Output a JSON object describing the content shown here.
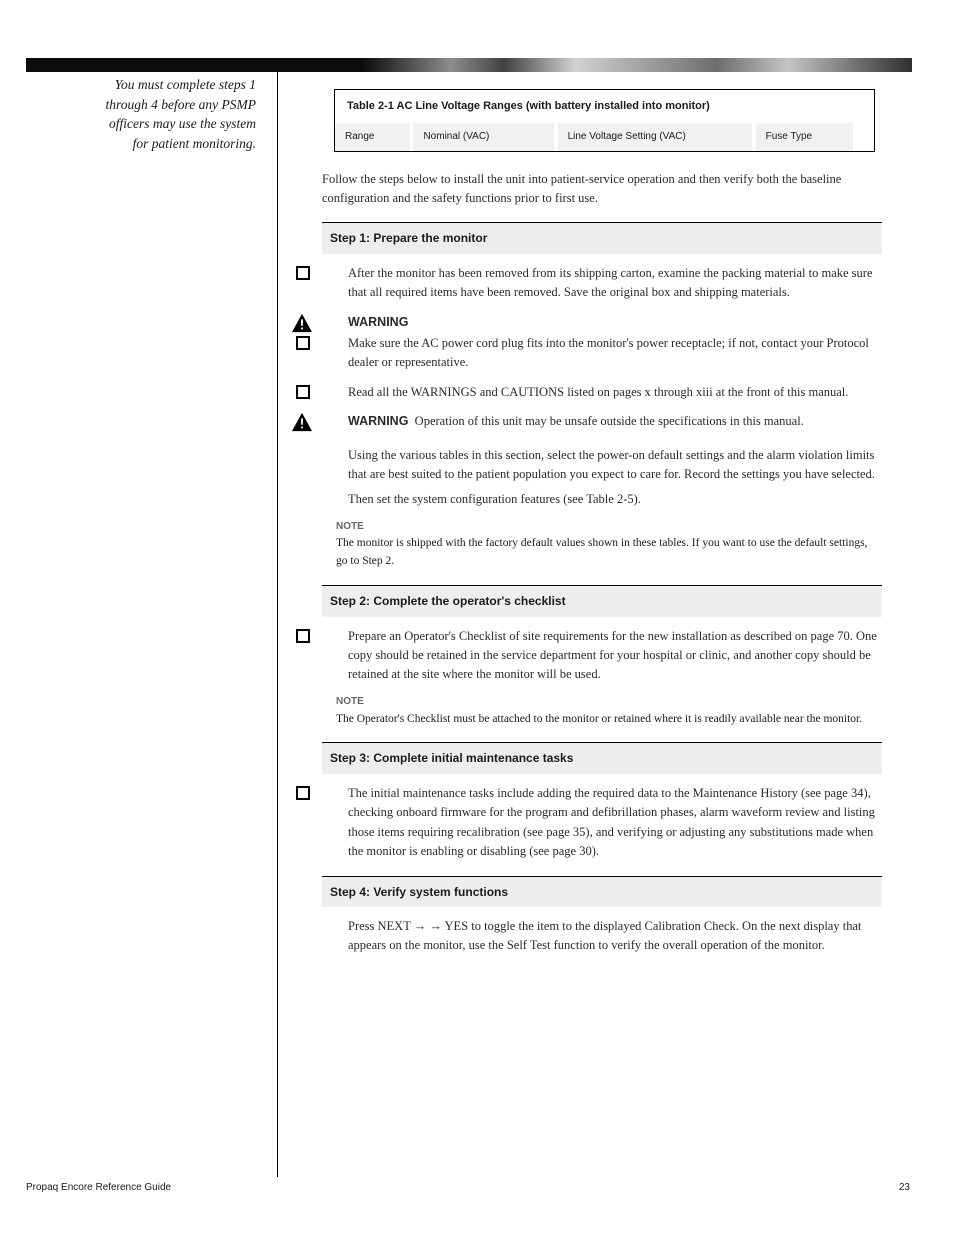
{
  "left": {
    "l1": "You must complete steps 1",
    "l2": "through 4 before any PSMP",
    "l3": "officers may use the system",
    "l4": "for patient monitoring."
  },
  "box": {
    "head": "Table 2-1  AC Line Voltage Ranges (with battery installed into monitor)",
    "c1": "Range",
    "c2": "Nominal (VAC)",
    "c3": "Line Voltage Setting (VAC)",
    "c4": "Fuse Type"
  },
  "lead": "Follow the steps below to install the unit into patient-service operation and then verify both the baseline configuration and the safety functions prior to first use.",
  "step1": "Step 1: Prepare the monitor",
  "s1a": "After the monitor has been removed from its shipping carton, examine the packing material to make sure that all required items have been removed. Save the original box and shipping materials.",
  "w1": "WARNING",
  "s1b": "Make sure the AC power cord plug fits into the monitor's power receptacle; if not, contact your Protocol dealer or representative.",
  "s1c": "Read all the WARNINGS and CAUTIONS listed on pages x through xiii at the front of this manual.",
  "w2": "WARNING",
  "s1d": "Operation of this unit may be unsafe outside the specifications in this manual.",
  "s1e": "Using the various tables in this section, select the power-on default settings and the alarm violation limits that are best suited to the patient population you expect to care for. Record the settings you have selected.",
  "s1f": "Then set the system configuration features (see Table 2-5).",
  "note1": "NOTE",
  "note1t": "The monitor is shipped with the factory default values shown in these tables. If you want to use the default settings, go to Step 2.",
  "step2": "Step 2: Complete the operator's checklist",
  "s2a": "Prepare an Operator's Checklist of site requirements for the new installation as described on page 70. One copy should be retained in the service department for your hospital or clinic, and another copy should be retained at the site where the monitor will be used.",
  "note2": "NOTE",
  "note2t": "The Operator's Checklist must be attached to the monitor or retained where it is readily available near the monitor.",
  "step3": "Step 3: Complete initial maintenance tasks",
  "s3a": "The initial maintenance tasks include adding the required data to the Maintenance History (see page 34), checking onboard firmware for the program and defibrillation phases, alarm waveform review and listing those items requiring recalibration (see page 35), and verifying or adjusting any substitutions made when the monitor is enabling or disabling (see page 30).",
  "step4": "Step 4: Verify system functions",
  "s4a": "Press NEXT → → YES to toggle the item to the displayed Calibration Check. On the next display that appears on the monitor, use the Self Test function to verify the overall operation of the monitor.",
  "footL": "Propaq Encore Reference Guide",
  "footR": "23"
}
